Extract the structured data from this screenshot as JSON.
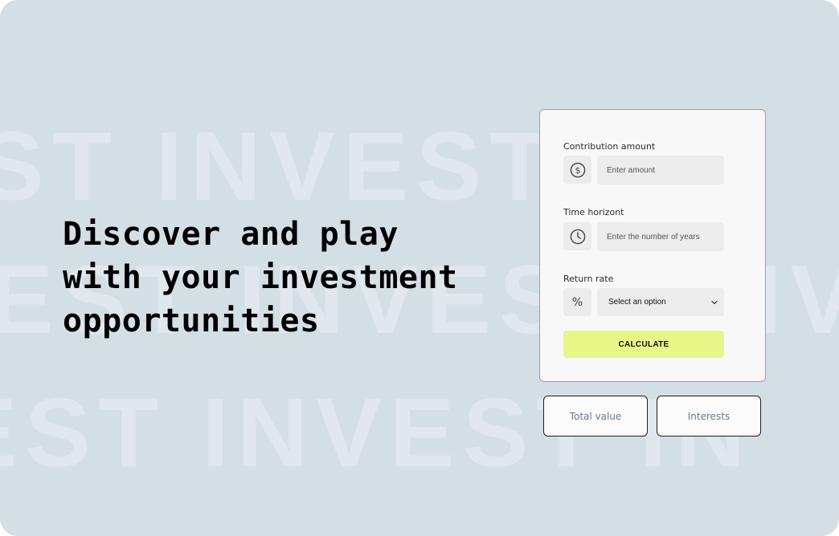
{
  "background": {
    "watermark_rows": [
      "EST INVEST IN",
      "VEST INVEST INV",
      "EST INVEST IN"
    ]
  },
  "headline": {
    "lines": [
      "Discover and play",
      "with your investment",
      "opportunities"
    ]
  },
  "form": {
    "contribution": {
      "label": "Contribution amount",
      "placeholder": "Enter amount",
      "icon": "dollar-circle-icon"
    },
    "time_horizon": {
      "label": "Time horizont",
      "placeholder": "Enter the number of years",
      "icon": "clock-icon"
    },
    "return_rate": {
      "label": "Return rate",
      "icon_glyph": "%",
      "selected_value": "Select an option",
      "icon": "percent-icon"
    },
    "calculate_label": "CALCULATE"
  },
  "results": {
    "total_value_label": "Total value",
    "interests_label": "Interests"
  },
  "colors": {
    "background": "#d3dee5",
    "watermark": "#e1e7ee",
    "accent_button": "#e6f788",
    "card": "#f8f8f8"
  }
}
